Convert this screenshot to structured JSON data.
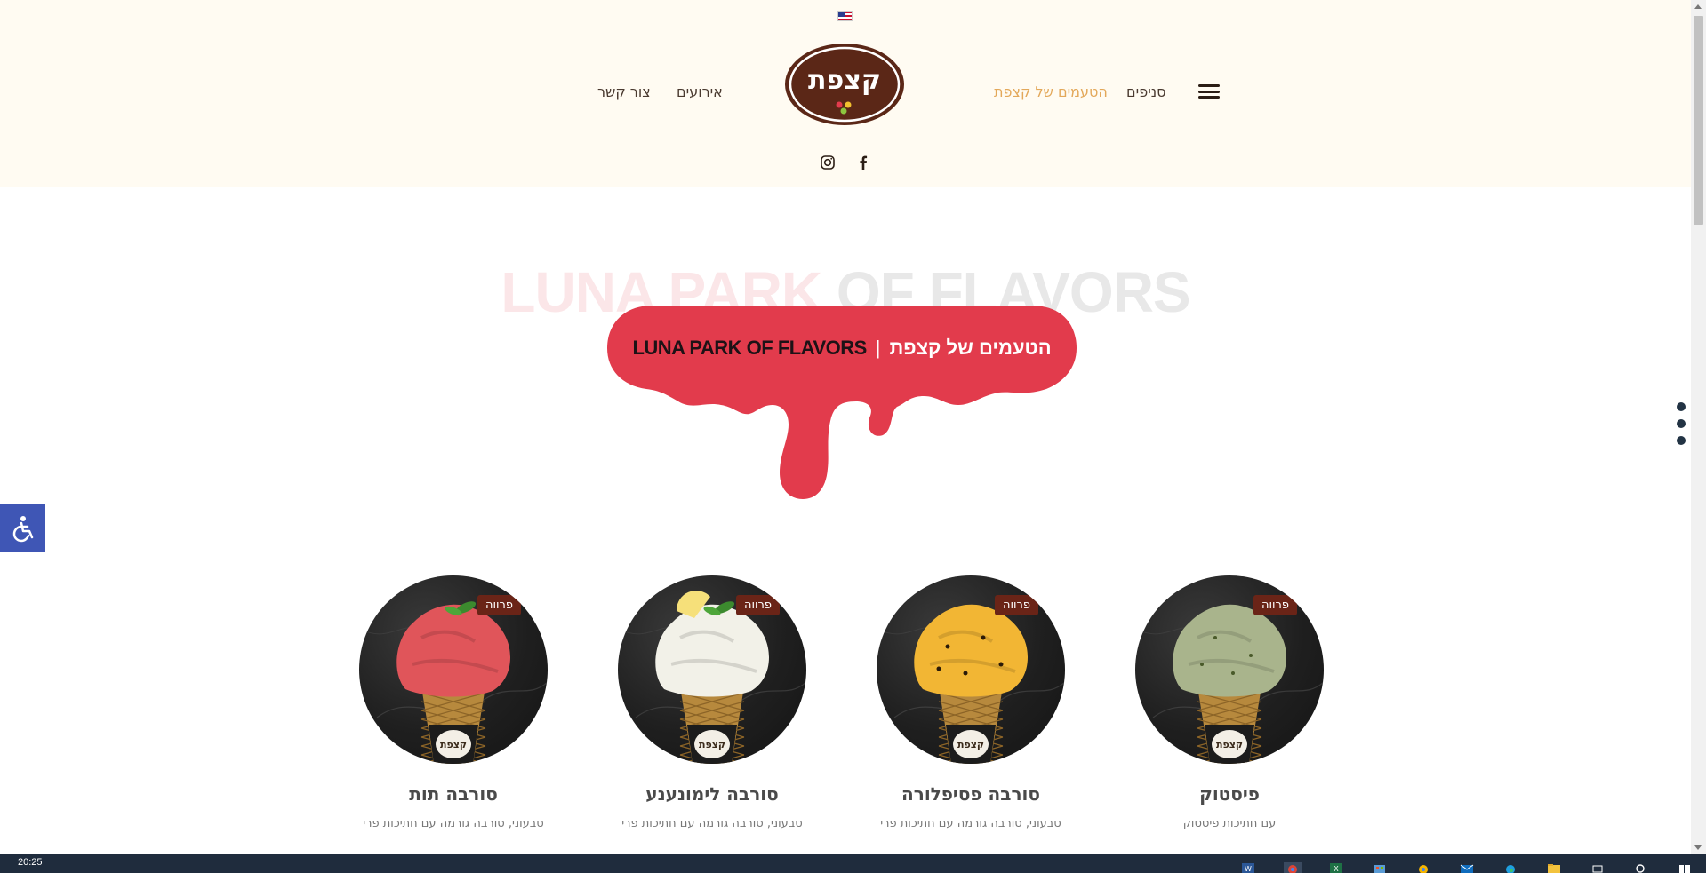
{
  "header": {
    "language_flag": "us-flag-icon",
    "nav": {
      "contact": "צור קשר",
      "events": "אירועים",
      "flavors": "הטעמים של קצפת",
      "branches": "סניפים"
    },
    "logo_text": "קצפת",
    "social": [
      "instagram-icon",
      "facebook-icon"
    ]
  },
  "hero": {
    "bg_title_word1": "LUNA PARK",
    "bg_title_word2": "OF FLAVORS",
    "banner_hebrew": "הטעמים של קצפת",
    "banner_separator": "|",
    "banner_english": "LUNA PARK OF FLAVORS",
    "drip_color": "#e23b4c"
  },
  "products": [
    {
      "name": "סורבה תות",
      "tag": "פרווה",
      "desc": "טבעוני, סורבה גורמה עם חתיכות פרי",
      "scoop_color": "#e0555a"
    },
    {
      "name": "סורבה לימונענע",
      "tag": "פרווה",
      "desc": "טבעוני, סורבה גורמה עם חתיכות פרי",
      "scoop_color": "#f2f1e8"
    },
    {
      "name": "סורבה פסיפלורה",
      "tag": "פרווה",
      "desc": "טבעוני, סורבה גורמה עם חתיכות פרי",
      "scoop_color": "#f2b634"
    },
    {
      "name": "פיסטוק",
      "tag": "פרווה",
      "desc": "עם חתיכות פיסטוק",
      "scoop_color": "#a9b48c"
    }
  ],
  "cone_logo_text": "קצפת",
  "taskbar": {
    "clock": "20:25"
  },
  "colors": {
    "header_bg": "#fffbf2",
    "brand_brown": "#5b2717",
    "accent_gold": "#e3a85a",
    "tag_bg": "#6a2417",
    "accessibility_blue": "#3f56b5"
  }
}
